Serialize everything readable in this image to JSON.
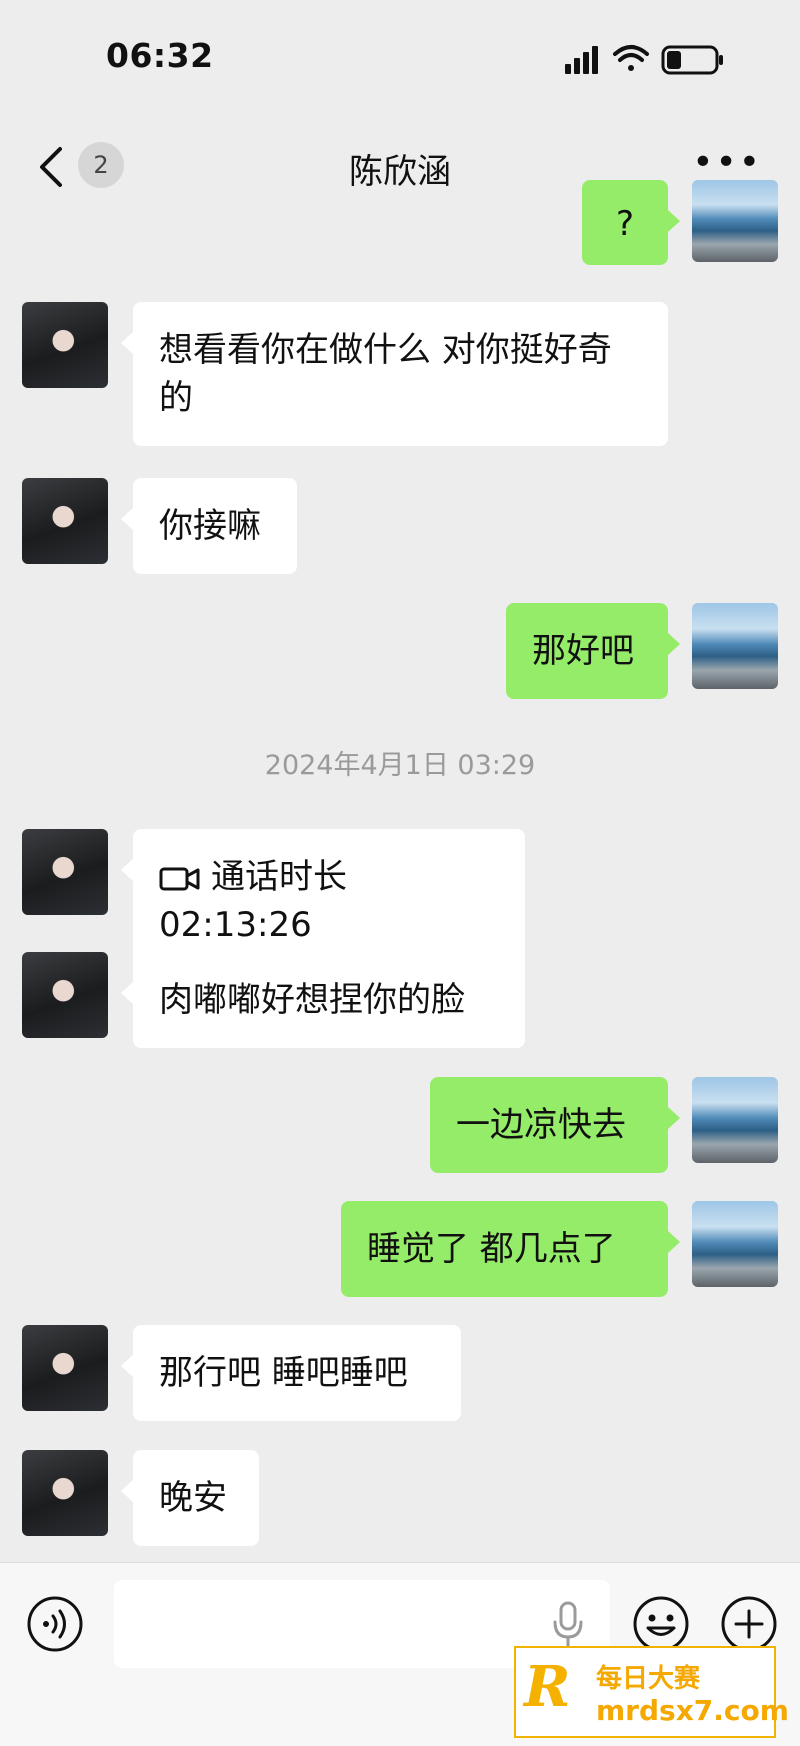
{
  "status_bar": {
    "time": "06:32"
  },
  "header": {
    "back_badge": "2",
    "title": "陈欣涵"
  },
  "messages": [
    {
      "side": "right",
      "text": "?"
    },
    {
      "side": "left",
      "text": "想看看你在做什么 对你挺好奇的"
    },
    {
      "side": "left",
      "text": "你接嘛"
    },
    {
      "side": "right",
      "text": "那好吧"
    },
    {
      "side": "left",
      "text": "通话时长 02:13:26"
    },
    {
      "side": "left",
      "text": "肉嘟嘟好想捏你的脸"
    },
    {
      "side": "right",
      "text": "一边凉快去"
    },
    {
      "side": "right",
      "text": "睡觉了 都几点了"
    },
    {
      "side": "left",
      "text": "那行吧 睡吧睡吧"
    },
    {
      "side": "left",
      "text": "晚安"
    }
  ],
  "timestamp": "2024年4月1日 03:29",
  "watermark": {
    "letter": "R",
    "line1": "每日大赛",
    "line2": "mrdsx7.com"
  },
  "colors": {
    "background": "#ededed",
    "incoming_bubble": "#ffffff",
    "outgoing_bubble": "#95ec69",
    "watermark": "#f5a800"
  }
}
